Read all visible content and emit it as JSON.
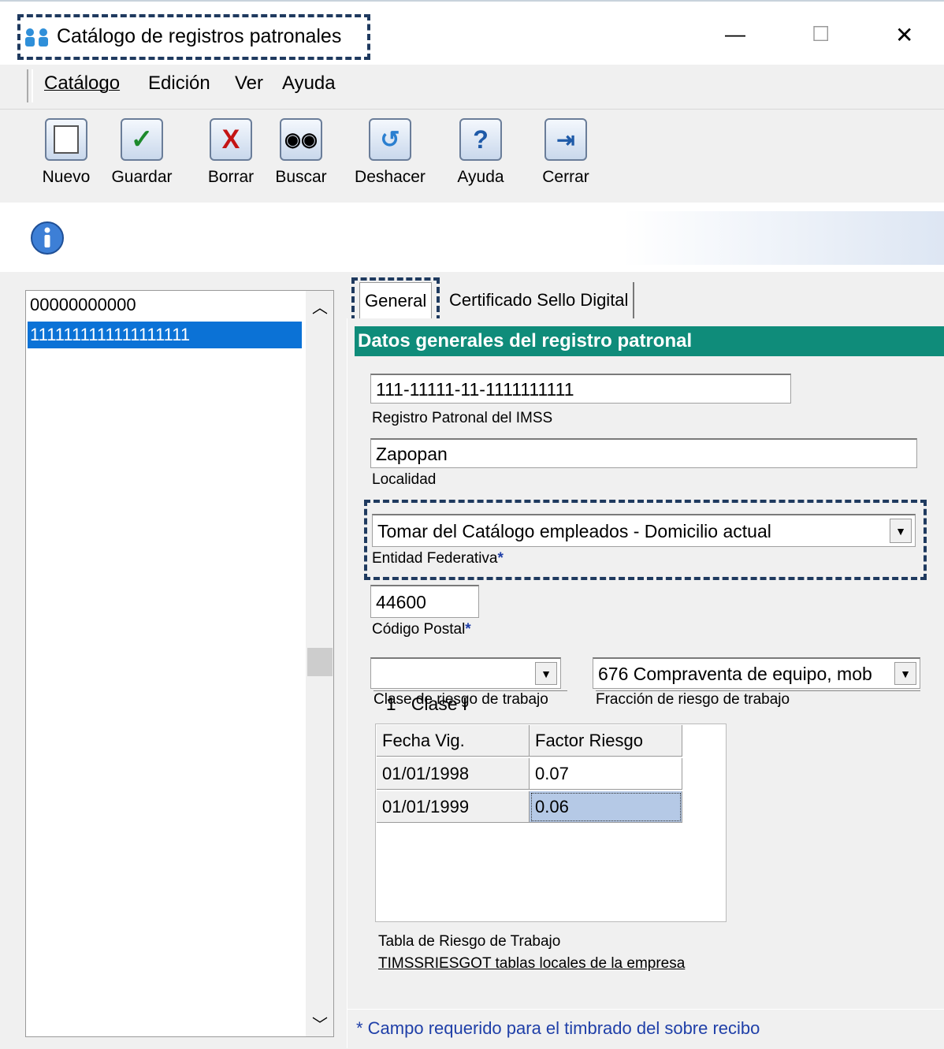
{
  "window": {
    "title": "Catálogo de registros patronales",
    "controls": {
      "minimize": "—",
      "maximize": "☐",
      "close": "✕"
    }
  },
  "menu": [
    {
      "label": "Catálogo"
    },
    {
      "label": "Edición"
    },
    {
      "label": "Ver"
    },
    {
      "label": "Ayuda"
    }
  ],
  "toolbar": {
    "nuevo": "Nuevo",
    "guardar": "Guardar",
    "borrar": "Borrar",
    "buscar": "Buscar",
    "deshacer": "Deshacer",
    "ayuda": "Ayuda",
    "cerrar": "Cerrar"
  },
  "list": {
    "items": [
      "00000000000",
      "1111111111111111111"
    ],
    "selected_index": 1
  },
  "tabs": {
    "general": "General",
    "certificado": "Certificado Sello Digital",
    "active": "General"
  },
  "section_header": "Datos generales del registro patronal",
  "form": {
    "registro_value": "111-11111-11-1111111111",
    "registro_label": "Registro Patronal del IMSS",
    "localidad_value": "Zapopan",
    "localidad_label": "Localidad",
    "entidad_value": "Tomar del Catálogo empleados - Domicilio actual",
    "entidad_label": "Entidad Federativa",
    "cp_value": "44600",
    "cp_label": "Código Postal",
    "clase_value": "1   Clase I",
    "clase_label": "Clase de riesgo de trabajo",
    "fraccion_value": "676 Compraventa de equipo, mob",
    "fraccion_label": "Fracción de riesgo de trabajo",
    "required_mark": "*"
  },
  "grid": {
    "columns": [
      "Fecha Vig.",
      "Factor Riesgo"
    ],
    "rows": [
      [
        "01/01/1998",
        "0.07"
      ],
      [
        "01/01/1999",
        "0.06"
      ]
    ]
  },
  "table_caption": "Tabla de Riesgo de Trabajo",
  "table_link": "TIMSSRIESGOT tablas locales de la empresa",
  "footer_note": "* Campo requerido para el timbrado del sobre recibo",
  "colors": {
    "accent_header": "#0f8c7a",
    "selection": "#0b72d6",
    "highlight_border": "#1f3a5f",
    "required": "#1f3fa8"
  }
}
